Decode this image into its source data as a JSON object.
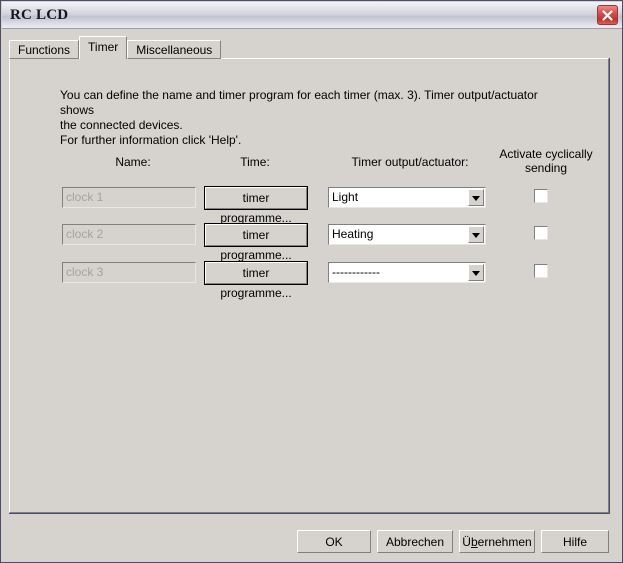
{
  "window": {
    "title": "RC LCD",
    "close_icon": "close-x-icon"
  },
  "tabs": [
    {
      "label": "Functions",
      "active": false
    },
    {
      "label": "Timer",
      "active": true
    },
    {
      "label": "Miscellaneous",
      "active": false
    }
  ],
  "panel": {
    "description_line1": "You can define the name and timer program for each timer (max. 3). Timer output/actuator shows",
    "description_line2": "the connected devices.",
    "description_line3": "For further information click 'Help'.",
    "headers": {
      "name": "Name:",
      "time": "Time:",
      "output": "Timer output/actuator:",
      "cyclic_line1": "Activate cyclically",
      "cyclic_line2": "sending"
    },
    "rows": [
      {
        "name_value": "clock 1",
        "name_disabled": true,
        "time_button": "timer programme...",
        "output_value": "Light",
        "cyclic_checked": false,
        "dropdown_icon": "chevron-down-icon"
      },
      {
        "name_value": "clock 2",
        "name_disabled": true,
        "time_button": "timer programme...",
        "output_value": "Heating",
        "cyclic_checked": false,
        "dropdown_icon": "chevron-down-icon"
      },
      {
        "name_value": "clock 3",
        "name_disabled": true,
        "time_button": "timer programme...",
        "output_value": "------------",
        "cyclic_checked": false,
        "dropdown_icon": "chevron-down-icon"
      }
    ]
  },
  "footer": {
    "ok": "OK",
    "cancel": "Abbrechen",
    "apply_prefix": "Ü",
    "apply_accel": "b",
    "apply_suffix": "ernehmen",
    "help": "Hilfe"
  },
  "colors": {
    "dialog_face": "#d6d3ce",
    "close_red": "#c0332d",
    "window_frame": "#4a4d6b",
    "disabled_text": "#a6a29c"
  }
}
